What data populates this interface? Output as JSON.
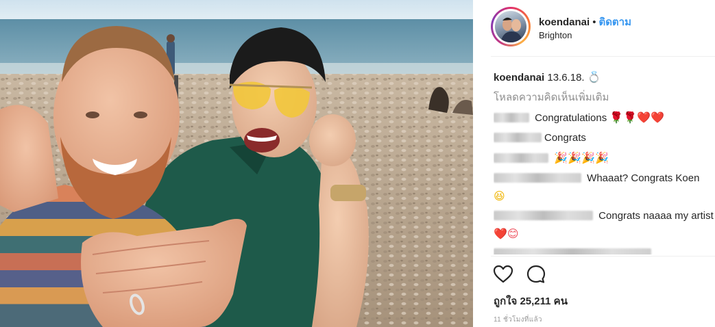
{
  "post": {
    "username": "koendanai",
    "separator": "•",
    "follow_label": "ติดตาม",
    "location": "Brighton"
  },
  "caption": {
    "username": "koendanai",
    "text": "13.6.18.",
    "emoji": "💍"
  },
  "load_more_label": "โหลดความคิดเห็นเพิ่มเติม",
  "comments": [
    {
      "text": "Congratulations",
      "emoji": "🌹🌹❤️❤️"
    },
    {
      "text": "Congrats",
      "emoji": ""
    },
    {
      "text": "",
      "emoji": "🎉🎉🎉🎉"
    },
    {
      "text": "Whaaat? Congrats Koen",
      "emoji": "😆"
    },
    {
      "text": "Congrats naaaa my artist",
      "emoji": "❤️😊"
    }
  ],
  "likes_text": "ถูกใจ 25,211 คน",
  "time_text": "11 ชั่วโมงที่แล้ว",
  "icons": {
    "like": "heart-icon",
    "comment": "comment-bubble-icon",
    "engagement": "ring-icon"
  },
  "colors": {
    "follow": "#3897f0",
    "text": "#262626",
    "muted": "#8e8e8e"
  }
}
